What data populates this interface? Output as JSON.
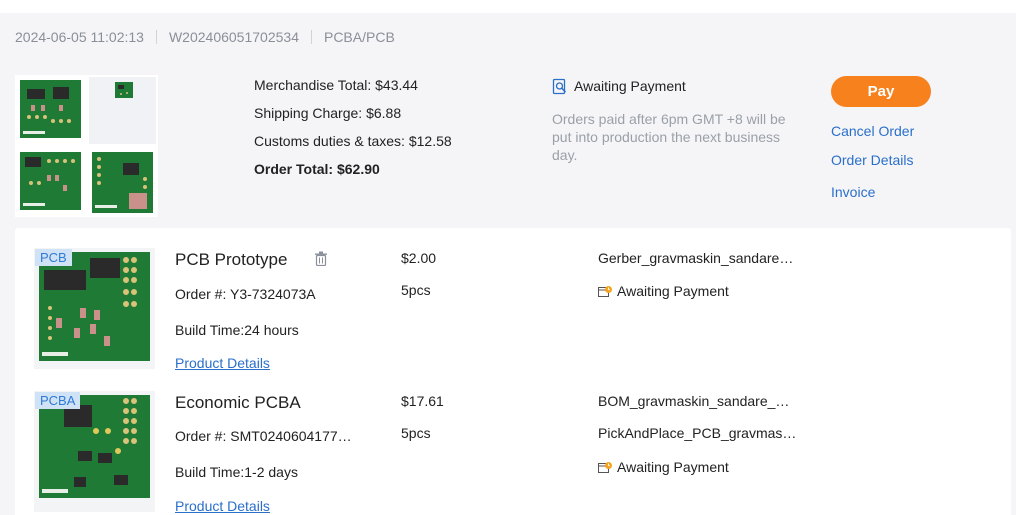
{
  "order": {
    "date": "2024-06-05 11:02:13",
    "number": "W202406051702534",
    "category": "PCBA/PCB"
  },
  "summary": {
    "merchandise": "Merchandise Total: $43.44",
    "shipping": "Shipping Charge: $6.88",
    "customs": "Customs duties & taxes: $12.58",
    "total": "Order Total: $62.90"
  },
  "status": {
    "label": "Awaiting Payment",
    "note": "Orders paid after 6pm GMT +8 will be put into production the next business day.",
    "icon": "search-doc-icon"
  },
  "actions": {
    "pay": "Pay",
    "cancel": "Cancel Order",
    "details": "Order Details",
    "invoice": "Invoice"
  },
  "items": [
    {
      "badge": "PCB",
      "name": "PCB Prototype",
      "order_no": "Order #: Y3-7324073A",
      "build_time": "Build Time:24 hours",
      "link": "Product Details",
      "price": "$2.00",
      "qty": "5pcs",
      "files": [
        "Gerber_gravmaskin_sandare…"
      ],
      "file_status": "Awaiting Payment"
    },
    {
      "badge": "PCBA",
      "name": "Economic PCBA",
      "order_no": "Order #: SMT0240604177…",
      "build_time": "Build Time:1-2 days",
      "link": "Product Details",
      "price": "$17.61",
      "qty": "5pcs",
      "files": [
        "BOM_gravmaskin_sandare_…",
        "PickAndPlace_PCB_gravmas…"
      ],
      "file_status": "Awaiting Payment"
    }
  ],
  "colors": {
    "accent": "#f7811c",
    "link": "#2a6fca",
    "pcb_green": "#1f7a35"
  }
}
